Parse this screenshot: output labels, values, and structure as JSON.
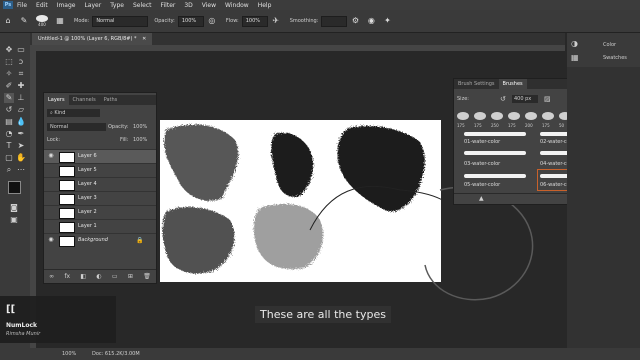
{
  "menubar": {
    "app_icon": "Ps",
    "items": [
      "File",
      "Edit",
      "Image",
      "Layer",
      "Type",
      "Select",
      "Filter",
      "3D",
      "View",
      "Window",
      "Help"
    ]
  },
  "options": {
    "brush_size": "400",
    "mode_label": "Mode:",
    "mode_value": "Normal",
    "opacity_label": "Opacity:",
    "opacity_value": "100%",
    "flow_label": "Flow:",
    "flow_value": "100%",
    "smoothing_label": "Smoothing:"
  },
  "document": {
    "tab_title": "Untitled-1 @ 100% (Layer 6, RGB/8#) *",
    "zoom_status": "100%",
    "doc_status": "Doc: 615.2K/3.00M"
  },
  "layers_panel": {
    "tabs": [
      "Layers",
      "Channels",
      "Paths"
    ],
    "kind_label": "Kind",
    "blend_mode": "Normal",
    "opacity_label": "Opacity:",
    "opacity_value": "100%",
    "lock_label": "Lock:",
    "fill_label": "Fill:",
    "fill_value": "100%",
    "layers": [
      {
        "name": "Layer 6",
        "visible": true,
        "selected": true
      },
      {
        "name": "Layer 5",
        "visible": false,
        "selected": false
      },
      {
        "name": "Layer 4",
        "visible": false,
        "selected": false
      },
      {
        "name": "Layer 3",
        "visible": false,
        "selected": false
      },
      {
        "name": "Layer 2",
        "visible": false,
        "selected": false
      },
      {
        "name": "Layer 1",
        "visible": false,
        "selected": false
      },
      {
        "name": "Background",
        "visible": true,
        "selected": false
      }
    ]
  },
  "brush_panel": {
    "tabs": [
      "Brush Settings",
      "Brushes"
    ],
    "size_label": "Size:",
    "size_value": "400 px",
    "presets": [
      "175",
      "175",
      "250",
      "175",
      "200",
      "175",
      "50"
    ],
    "brushes": [
      {
        "name": "01-water-color"
      },
      {
        "name": "02-water-color"
      },
      {
        "name": "03-water-color"
      },
      {
        "name": "04-water-color"
      },
      {
        "name": "05-water-color"
      },
      {
        "name": "06-water-color"
      }
    ]
  },
  "side_panels": {
    "color_label": "Color",
    "swatches_label": "Swatches"
  },
  "overlay": {
    "numlock_title": "NumLock",
    "numlock_user": "Rimsha Munir",
    "numlock_glyph": "[["
  },
  "caption": "These are all the types"
}
